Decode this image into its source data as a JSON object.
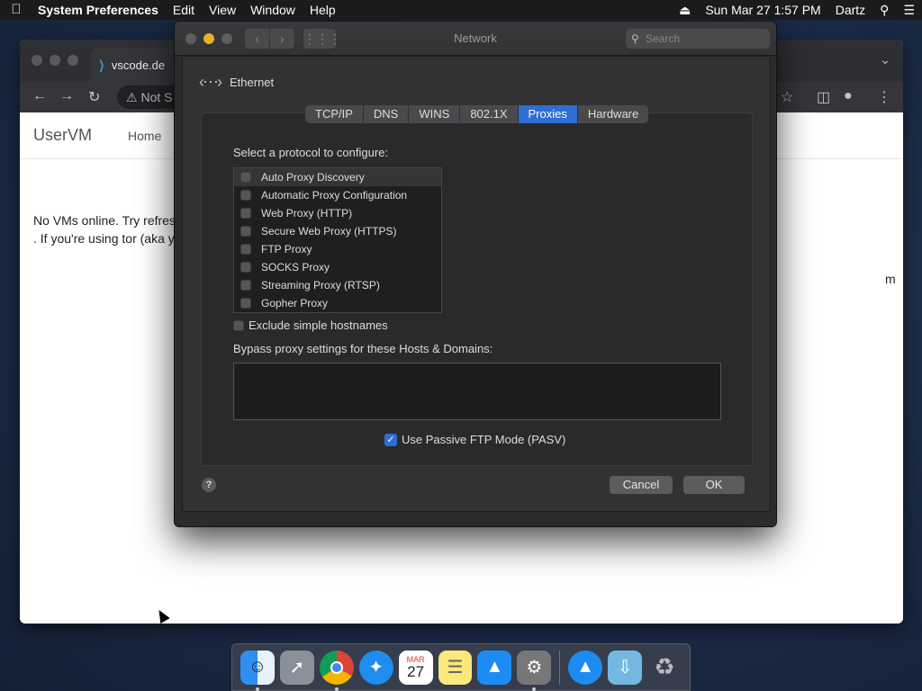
{
  "menubar": {
    "app_name": "System Preferences",
    "menus": [
      "Edit",
      "View",
      "Window",
      "Help"
    ],
    "datetime": "Sun Mar 27  1:57 PM",
    "user": "Dartz"
  },
  "browser": {
    "tab_title": "vscode.de",
    "omnibox_text": "Not S",
    "brand": "UserVM",
    "nav_home": "Home",
    "content_line1": "No VMs online. Try refres",
    "content_line2": ". If you're using tor (aka y",
    "right_clip": "m"
  },
  "network_window": {
    "title": "Network",
    "search_placeholder": "Search",
    "interface_name": "Ethernet",
    "tabs": [
      {
        "label": "TCP/IP",
        "active": false
      },
      {
        "label": "DNS",
        "active": false
      },
      {
        "label": "WINS",
        "active": false
      },
      {
        "label": "802.1X",
        "active": false
      },
      {
        "label": "Proxies",
        "active": true
      },
      {
        "label": "Hardware",
        "active": false
      }
    ],
    "protocol_label": "Select a protocol to configure:",
    "protocols": [
      {
        "label": "Auto Proxy Discovery",
        "checked": false
      },
      {
        "label": "Automatic Proxy Configuration",
        "checked": false
      },
      {
        "label": "Web Proxy (HTTP)",
        "checked": false
      },
      {
        "label": "Secure Web Proxy (HTTPS)",
        "checked": false
      },
      {
        "label": "FTP Proxy",
        "checked": false
      },
      {
        "label": "SOCKS Proxy",
        "checked": false
      },
      {
        "label": "Streaming Proxy (RTSP)",
        "checked": false
      },
      {
        "label": "Gopher Proxy",
        "checked": false
      }
    ],
    "exclude_simple_hostnames": {
      "label": "Exclude simple hostnames",
      "checked": false
    },
    "bypass_label": "Bypass proxy settings for these Hosts & Domains:",
    "bypass_value": "",
    "passive_ftp": {
      "label": "Use Passive FTP Mode (PASV)",
      "checked": true
    },
    "help_label": "?",
    "cancel_label": "Cancel",
    "ok_label": "OK"
  },
  "dock": {
    "apps": [
      "finder-icon",
      "launchpad-icon",
      "chrome-icon",
      "safari-icon",
      "calendar-icon",
      "notes-icon",
      "app-store-icon",
      "system-preferences-icon",
      "app-store-download-icon",
      "downloads-folder-icon",
      "trash-icon"
    ],
    "calendar_month": "MAR",
    "calendar_day": "27"
  },
  "colors": {
    "accent": "#2f6ed3",
    "window_bg": "#2b2b2d",
    "desktop": "#1d2c44"
  }
}
